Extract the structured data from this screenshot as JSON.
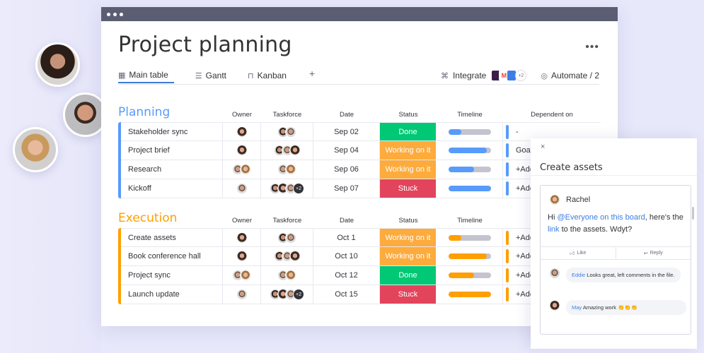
{
  "window": {
    "title": "Project planning",
    "more_label": "•••",
    "tabs": [
      {
        "label": "Main table",
        "icon": "table-icon",
        "glyph": "▦",
        "active": true
      },
      {
        "label": "Gantt",
        "icon": "gantt-icon",
        "glyph": "☰",
        "active": false
      },
      {
        "label": "Kanban",
        "icon": "kanban-icon",
        "glyph": "⊓",
        "active": false
      }
    ],
    "add_tab_label": "+",
    "integrate": {
      "label": "Integrate",
      "icon_glyph": "⌘",
      "more_count": "+2"
    },
    "automate": {
      "label": "Automate / 2",
      "icon_glyph": "◎"
    }
  },
  "columns": {
    "owner": "Owner",
    "taskforce": "Taskforce",
    "date": "Date",
    "status": "Status",
    "timeline": "Timeline",
    "dependent": "Dependent on"
  },
  "status_colors": {
    "Done": "#00c875",
    "Working on it": "#fdab3d",
    "Stuck": "#e2445c"
  },
  "groups": [
    {
      "title": "Planning",
      "color": "#579bfc",
      "rows": [
        {
          "name": "Stakeholder sync",
          "date": "Sep 02",
          "status": "Done",
          "timeline": 0.3,
          "dependent": "-"
        },
        {
          "name": "Project brief",
          "date": "Sep 04",
          "status": "Working on it",
          "timeline": 0.9,
          "dependent": "Goal"
        },
        {
          "name": "Research",
          "date": "Sep 06",
          "status": "Working on it",
          "timeline": 0.6,
          "dependent": "+Add"
        },
        {
          "name": "Kickoff",
          "date": "Sep 07",
          "status": "Stuck",
          "timeline": 1.0,
          "dependent": "+Add"
        }
      ]
    },
    {
      "title": "Execution",
      "color": "#ff9f00",
      "rows": [
        {
          "name": "Create assets",
          "date": "Oct 1",
          "status": "Working on it",
          "timeline": 0.3,
          "dependent": "+Add"
        },
        {
          "name": "Book conference hall",
          "date": "Oct 10",
          "status": "Working on it",
          "timeline": 0.9,
          "dependent": "+Add"
        },
        {
          "name": "Project sync",
          "date": "Oct 12",
          "status": "Done",
          "timeline": 0.6,
          "dependent": "+Add"
        },
        {
          "name": "Launch update",
          "date": "Oct 15",
          "status": "Stuck",
          "timeline": 1.0,
          "dependent": "+Add"
        }
      ]
    }
  ],
  "taskforce_more": "+2",
  "panel": {
    "close_label": "×",
    "title": "Create assets",
    "post": {
      "author": "Rachel",
      "body_prefix": "Hi ",
      "mention": "@Everyone on this board",
      "body_mid": ", here's the ",
      "link": "link",
      "body_suffix": " to the assets. Wdyt?",
      "like_label": "Like",
      "reply_label": "Reply"
    },
    "replies": [
      {
        "author": "Eddie",
        "text": " Looks great, left comments in the file."
      },
      {
        "author": "May",
        "text": " Amazing work 👏👏👏"
      }
    ]
  }
}
